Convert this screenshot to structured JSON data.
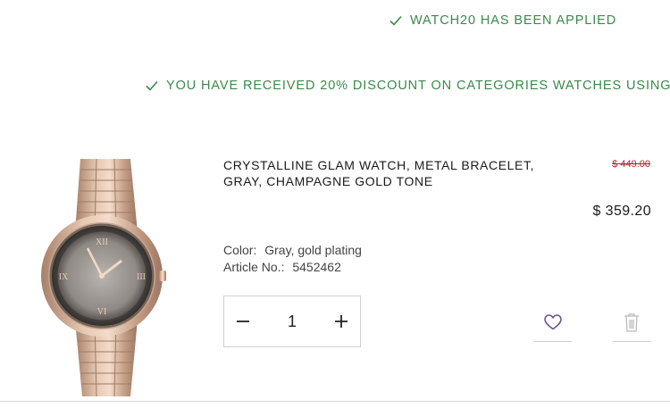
{
  "promos": {
    "code_applied": "WATCH20 HAS BEEN APPLIED",
    "discount": "YOU HAVE RECEIVED 20% DISCOUNT ON CATEGORIES WATCHES USING",
    "color": "#3a8a4a"
  },
  "item": {
    "title_line1": "CRYSTALLINE GLAM WATCH, METAL BRACELET,",
    "title_line2": "GRAY, CHAMPAGNE GOLD TONE",
    "original_price": "$ 449.00",
    "price": "$ 359.20",
    "color_label": "Color:",
    "color_value": "Gray, gold plating",
    "article_label": "Article No.:",
    "article_value": "5452462",
    "quantity": "1",
    "price_strike_color": "#b0222e"
  },
  "icons": {
    "check": "check-icon",
    "minus": "minus-icon",
    "plus": "plus-icon",
    "wishlist": "heart-icon",
    "remove": "trash-icon"
  }
}
